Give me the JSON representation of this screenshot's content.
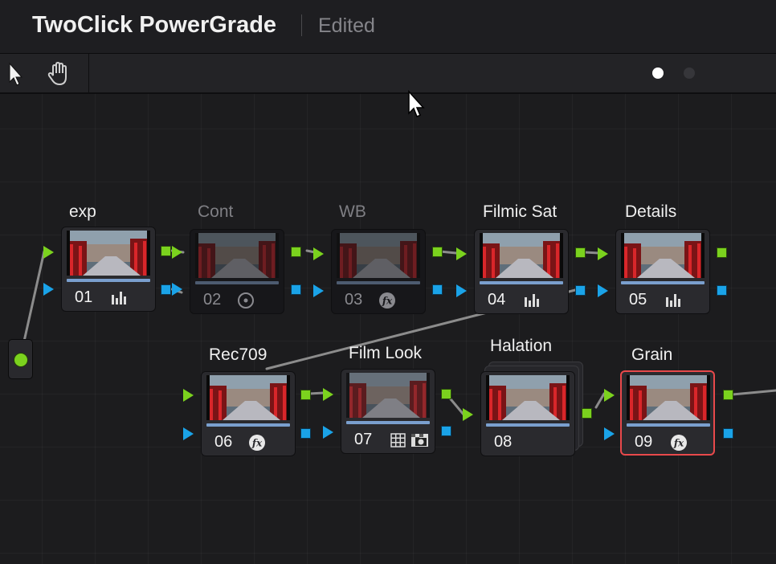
{
  "header": {
    "title": "TwoClick PowerGrade",
    "status": "Edited"
  },
  "toolbar": {
    "pointer_tool": "pointer-tool",
    "hand_tool": "hand-tool",
    "pages": 2,
    "active_page": 1
  },
  "nodes": [
    {
      "id": "01",
      "label": "exp",
      "icon": "histogram-icon",
      "enabled": true
    },
    {
      "id": "02",
      "label": "Cont",
      "icon": "circle-target-icon",
      "enabled": false
    },
    {
      "id": "03",
      "label": "WB",
      "icon": "fx-icon",
      "enabled": false
    },
    {
      "id": "04",
      "label": "Filmic Sat",
      "icon": "histogram-icon",
      "enabled": true
    },
    {
      "id": "05",
      "label": "Details",
      "icon": "histogram-icon",
      "enabled": true
    },
    {
      "id": "06",
      "label": "Rec709",
      "icon": "fx-icon",
      "enabled": true
    },
    {
      "id": "07",
      "label": "Film Look",
      "icon": "grid-icon,matte-icon",
      "enabled": true
    },
    {
      "id": "08",
      "label": "Halation",
      "icon": "",
      "enabled": true
    },
    {
      "id": "09",
      "label": "Grain",
      "icon": "fx-icon",
      "enabled": true,
      "selected": true
    }
  ],
  "colors": {
    "rgb_port": "#7bd21e",
    "alpha_port": "#1aa3e8",
    "selection": "#e8494b"
  }
}
